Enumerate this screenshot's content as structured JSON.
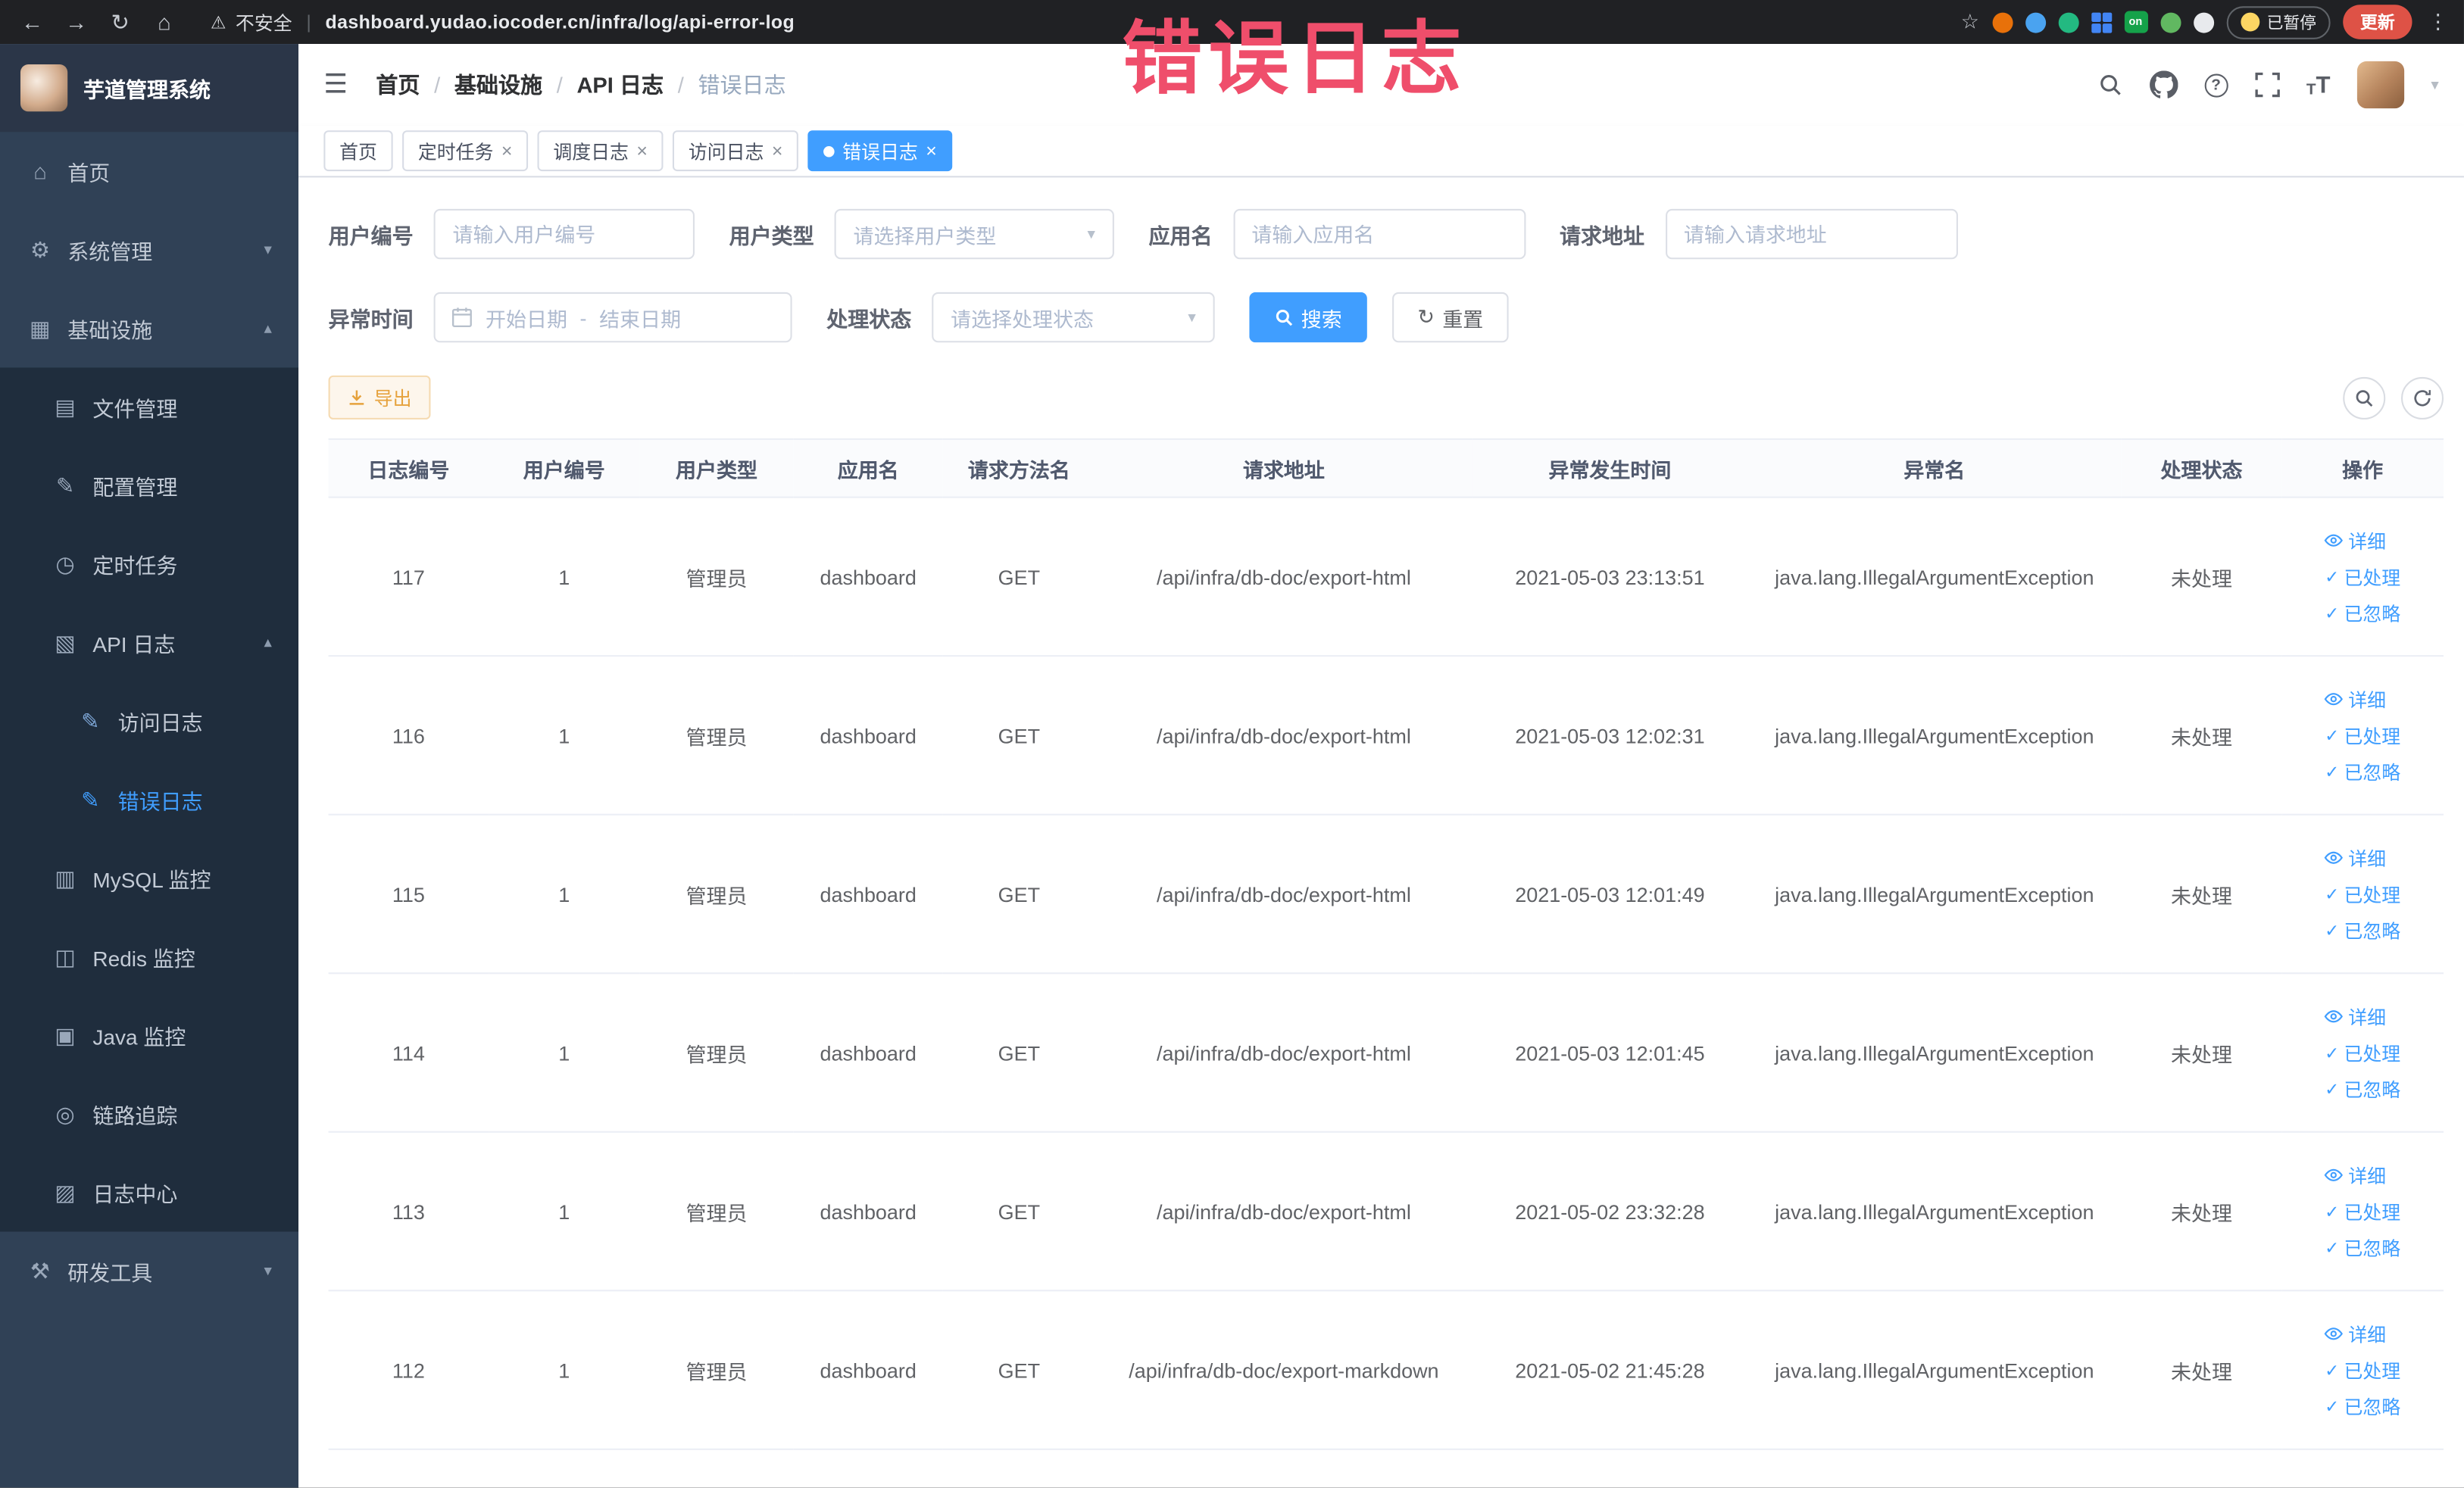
{
  "browser": {
    "security_label": "不安全",
    "url": "dashboard.yudao.iocoder.cn/infra/log/api-error-log",
    "paused_badge": "已暂停",
    "update_button": "更新",
    "extension_on_badge": "on"
  },
  "overlay_title": "错误日志",
  "icons": {
    "back": "←",
    "forward": "→",
    "reload": "↻",
    "home": "⌂",
    "warning": "⚠",
    "star": "☆",
    "kebab": "⋮",
    "hamburger": "☰",
    "chevron_down": "▾",
    "chevron_up": "▴",
    "caret_down": "▾",
    "check": "✓",
    "question": "?",
    "text_size_large": "T",
    "text_size_small": "T",
    "url_separator": "|",
    "date_separator": "-"
  },
  "sidebar": {
    "logo_title": "芋道管理系统",
    "items": [
      {
        "label": "首页",
        "icon": "⌂"
      },
      {
        "label": "系统管理",
        "icon": "⚙"
      },
      {
        "label": "基础设施",
        "icon": "▦"
      },
      {
        "label": "文件管理",
        "icon": "▤"
      },
      {
        "label": "配置管理",
        "icon": "✎"
      },
      {
        "label": "定时任务",
        "icon": "◷"
      },
      {
        "label": "API 日志",
        "icon": "▧"
      },
      {
        "label": "访问日志",
        "icon": "✎"
      },
      {
        "label": "错误日志",
        "icon": "✎"
      },
      {
        "label": "MySQL 监控",
        "icon": "▥"
      },
      {
        "label": "Redis 监控",
        "icon": "◫"
      },
      {
        "label": "Java 监控",
        "icon": "▣"
      },
      {
        "label": "链路追踪",
        "icon": "◎"
      },
      {
        "label": "日志中心",
        "icon": "▨"
      },
      {
        "label": "研发工具",
        "icon": "⚒"
      }
    ]
  },
  "header": {
    "breadcrumb": [
      "首页",
      "基础设施",
      "API 日志",
      "错误日志"
    ],
    "separator": "/"
  },
  "tabs": [
    {
      "label": "首页",
      "closable": false,
      "active": false
    },
    {
      "label": "定时任务",
      "closable": true,
      "active": false
    },
    {
      "label": "调度日志",
      "closable": true,
      "active": false
    },
    {
      "label": "访问日志",
      "closable": true,
      "active": false
    },
    {
      "label": "错误日志",
      "closable": true,
      "active": true
    }
  ],
  "tab_close": "×",
  "filters": {
    "user_id_label": "用户编号",
    "user_id_placeholder": "请输入用户编号",
    "user_type_label": "用户类型",
    "user_type_placeholder": "请选择用户类型",
    "app_name_label": "应用名",
    "app_name_placeholder": "请输入应用名",
    "request_url_label": "请求地址",
    "request_url_placeholder": "请输入请求地址",
    "exception_time_label": "异常时间",
    "start_date_placeholder": "开始日期",
    "end_date_placeholder": "结束日期",
    "process_status_label": "处理状态",
    "process_status_placeholder": "请选择处理状态",
    "search_button": "搜索",
    "reset_button": "重置"
  },
  "toolbar": {
    "export_button": "导出"
  },
  "table": {
    "columns": [
      "日志编号",
      "用户编号",
      "用户类型",
      "应用名",
      "请求方法名",
      "请求地址",
      "异常发生时间",
      "异常名",
      "处理状态",
      "操作"
    ],
    "actions": {
      "detail": "详细",
      "processed": "已处理",
      "ignored": "已忽略"
    },
    "rows": [
      {
        "id": "117",
        "user_id": "1",
        "user_type": "管理员",
        "app": "dashboard",
        "method": "GET",
        "url": "/api/infra/db-doc/export-html",
        "time": "2021-05-03 23:13:51",
        "exception": "java.lang.IllegalArgumentException",
        "status": "未处理"
      },
      {
        "id": "116",
        "user_id": "1",
        "user_type": "管理员",
        "app": "dashboard",
        "method": "GET",
        "url": "/api/infra/db-doc/export-html",
        "time": "2021-05-03 12:02:31",
        "exception": "java.lang.IllegalArgumentException",
        "status": "未处理"
      },
      {
        "id": "115",
        "user_id": "1",
        "user_type": "管理员",
        "app": "dashboard",
        "method": "GET",
        "url": "/api/infra/db-doc/export-html",
        "time": "2021-05-03 12:01:49",
        "exception": "java.lang.IllegalArgumentException",
        "status": "未处理"
      },
      {
        "id": "114",
        "user_id": "1",
        "user_type": "管理员",
        "app": "dashboard",
        "method": "GET",
        "url": "/api/infra/db-doc/export-html",
        "time": "2021-05-03 12:01:45",
        "exception": "java.lang.IllegalArgumentException",
        "status": "未处理"
      },
      {
        "id": "113",
        "user_id": "1",
        "user_type": "管理员",
        "app": "dashboard",
        "method": "GET",
        "url": "/api/infra/db-doc/export-html",
        "time": "2021-05-02 23:32:28",
        "exception": "java.lang.IllegalArgumentException",
        "status": "未处理"
      },
      {
        "id": "112",
        "user_id": "1",
        "user_type": "管理员",
        "app": "dashboard",
        "method": "GET",
        "url": "/api/infra/db-doc/export-markdown",
        "time": "2021-05-02 21:45:28",
        "exception": "java.lang.IllegalArgumentException",
        "status": "未处理"
      }
    ]
  },
  "colors": {
    "accent": "#409eff",
    "warning": "#e6a23c",
    "overlay_pink": "#ef4e6b",
    "sidebar_bg": "#304156",
    "submenu_bg": "#1f2d3d"
  }
}
